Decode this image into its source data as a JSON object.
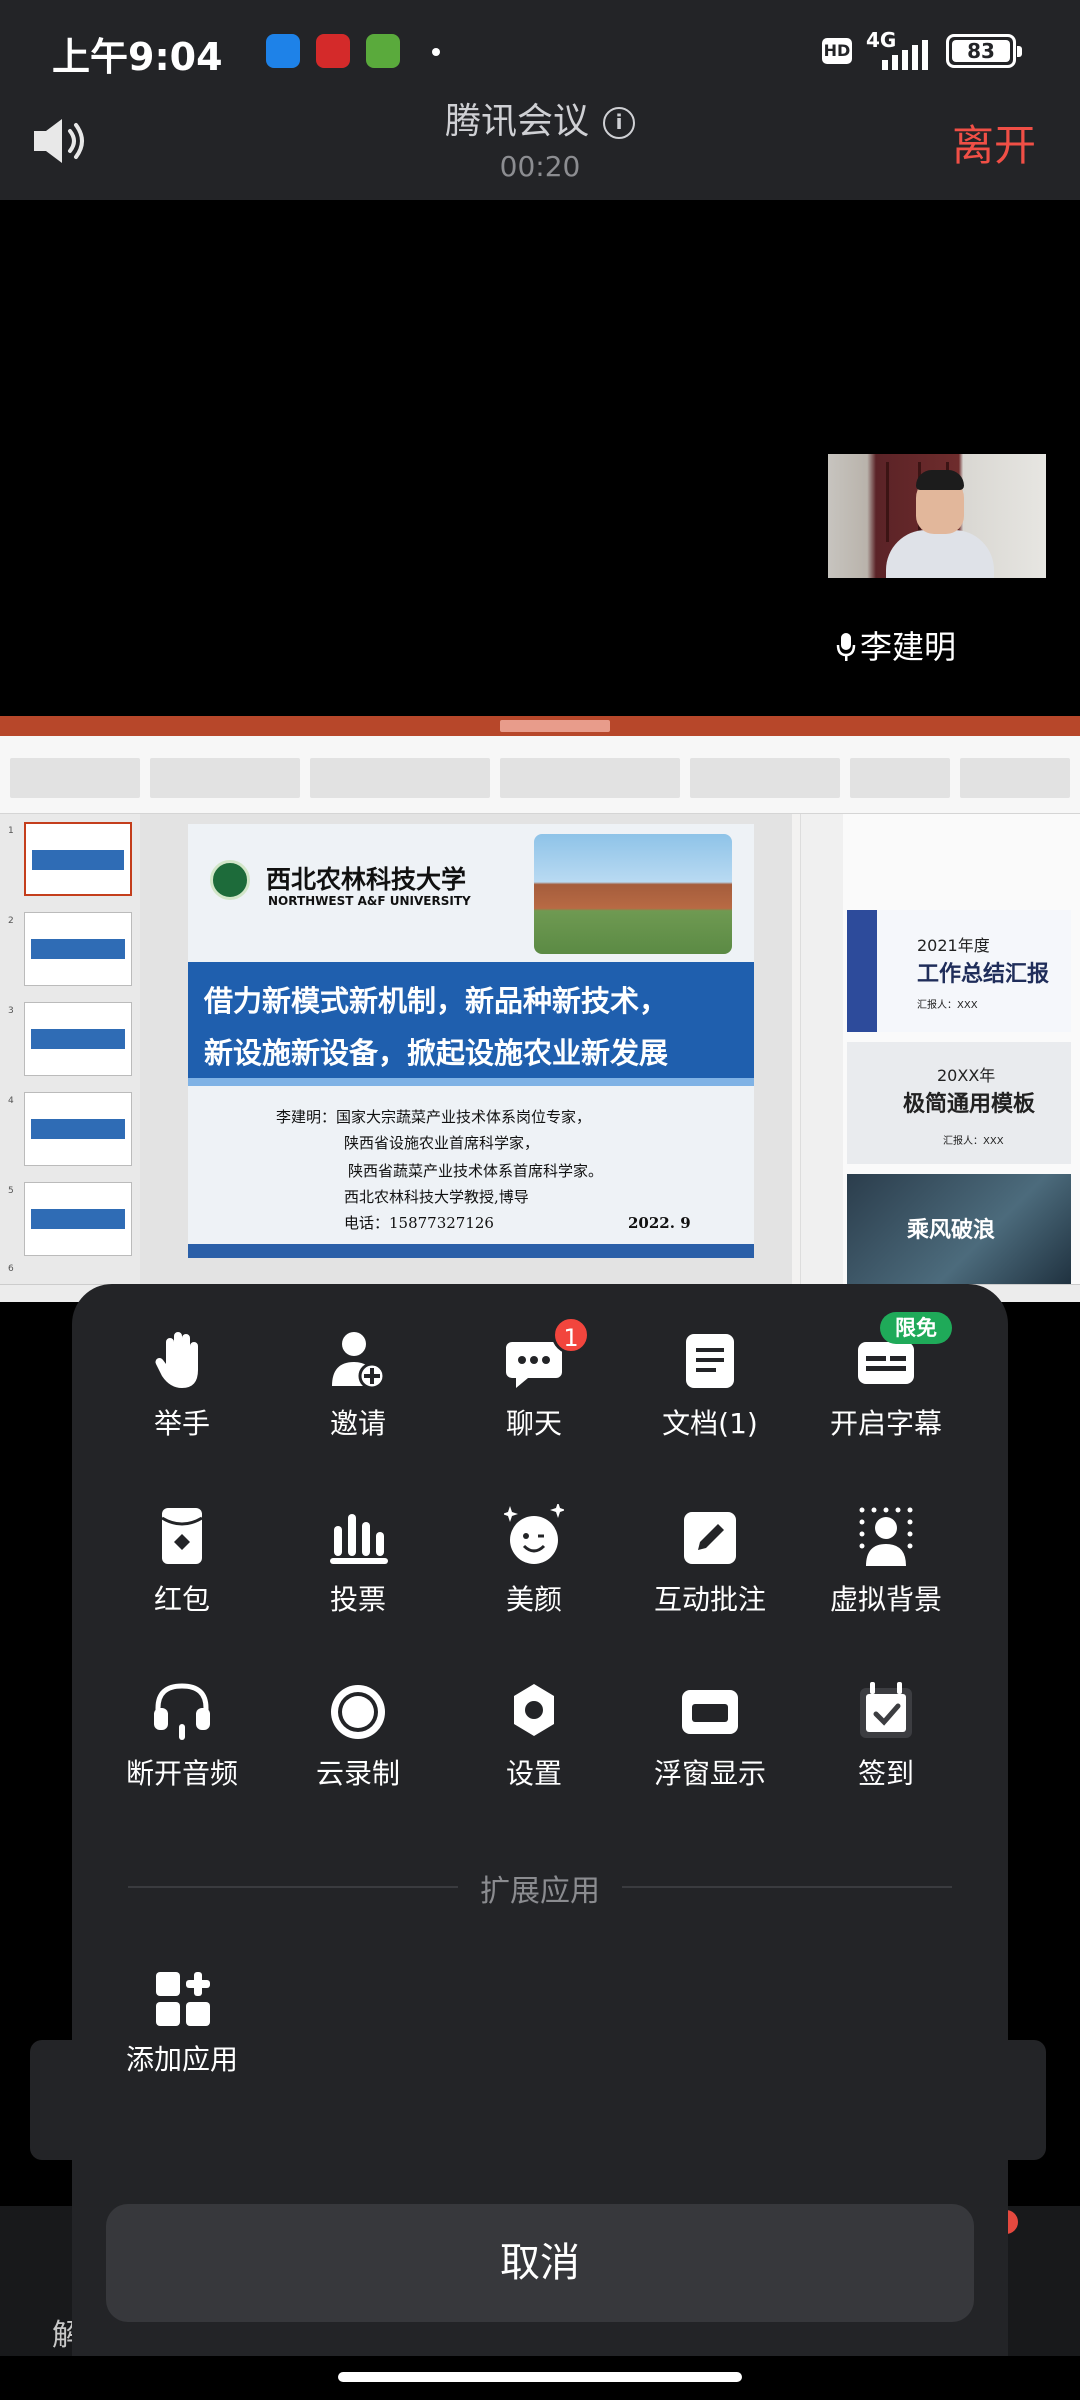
{
  "status_bar": {
    "time": "上午9:04",
    "hd": "HD",
    "network": "4G",
    "battery": "83"
  },
  "header": {
    "title": "腾讯会议",
    "timer": "00:20",
    "leave_label": "离开"
  },
  "video": {
    "participant_name": "李建明"
  },
  "shared_slide": {
    "university_cn": "西北农林科技大学",
    "university_en": "NORTHWEST A&F UNIVERSITY",
    "headline_line1": "借力新模式新机制，新品种新技术，",
    "headline_line2": "新设施新设备，掀起设施农业新发展",
    "body_lines": [
      "李建明：国家大宗蔬菜产业技术体系岗位专家，",
      "陕西省设施农业首席科学家，",
      "陕西省蔬菜产业技术体系首席科学家。",
      "西北农林科技大学教授,博导",
      "电话：15877327126"
    ],
    "date": "2022. 9",
    "thumbnail_numbers": [
      "1",
      "2",
      "3",
      "4",
      "5",
      "6"
    ],
    "templates": [
      {
        "year": "2021年度",
        "title": "工作总结汇报",
        "reporter": "汇报人：XXX"
      },
      {
        "year": "20XX年",
        "title": "极简通用模板",
        "reporter": "汇报人：XXX"
      },
      {
        "title": "乘风破浪"
      }
    ]
  },
  "menu": {
    "items": [
      {
        "label": "举手",
        "icon": "raise-hand-icon"
      },
      {
        "label": "邀请",
        "icon": "invite-icon"
      },
      {
        "label": "聊天",
        "icon": "chat-icon",
        "badge": "1"
      },
      {
        "label": "文档(1)",
        "icon": "document-icon"
      },
      {
        "label": "开启字幕",
        "icon": "captions-icon",
        "tag": "限免"
      },
      {
        "label": "红包",
        "icon": "red-packet-icon"
      },
      {
        "label": "投票",
        "icon": "vote-icon"
      },
      {
        "label": "美颜",
        "icon": "beauty-icon"
      },
      {
        "label": "互动批注",
        "icon": "annotate-icon"
      },
      {
        "label": "虚拟背景",
        "icon": "virtual-background-icon"
      },
      {
        "label": "断开音频",
        "icon": "headset-icon"
      },
      {
        "label": "云录制",
        "icon": "cloud-record-icon"
      },
      {
        "label": "设置",
        "icon": "settings-icon"
      },
      {
        "label": "浮窗显示",
        "icon": "floating-window-icon"
      },
      {
        "label": "签到",
        "icon": "check-in-icon"
      }
    ],
    "extension_section_title": "扩展应用",
    "add_app_label": "添加应用",
    "cancel_label": "取消"
  },
  "background": {
    "bottom_partial_text": "解"
  },
  "colors": {
    "header_bg": "#232427",
    "leave": "#f04f46",
    "sheet_bg": "#232427",
    "badge_red": "#f2453d",
    "free_green": "#1faa59"
  }
}
